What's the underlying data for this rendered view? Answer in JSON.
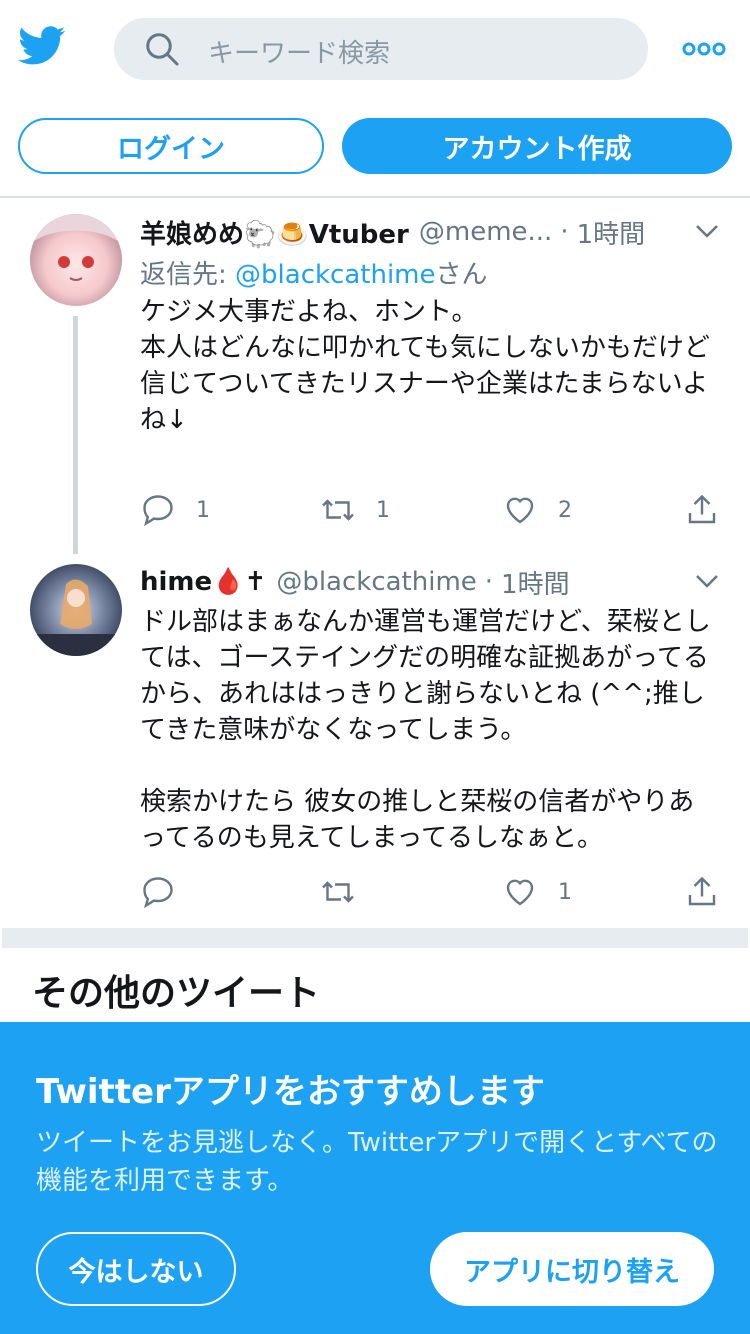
{
  "header": {
    "logo_icon": "twitter-bird-icon",
    "search_placeholder": "キーワード検索",
    "search_icon": "search-icon",
    "more_icon": "more-dots-icon"
  },
  "auth": {
    "login_label": "ログイン",
    "signup_label": "アカウント作成"
  },
  "tweets": [
    {
      "name": "羊娘めめ🐑🍮Vtuber",
      "handle": "@meme...",
      "separator": "·",
      "time": "1時間",
      "reply_prefix": "返信先: ",
      "reply_handle": "@blackcathime",
      "reply_suffix": "さん",
      "body": "ケジメ大事だよね、ホント。\n本人はどんなに叩かれても気にしないかもだけど\n信じてついてきたリスナーや企業はたまらないよね↓",
      "replies": "1",
      "retweets": "1",
      "likes": "2"
    },
    {
      "name": "hime🩸✝",
      "handle": "@blackcathime",
      "separator": "·",
      "time": "1時間",
      "body": "ドル部はまぁなんか運営も運営だけど、栞桜としては、ゴーステイングだの明確な証拠あがってるから、あれははっきりと謝らないとね (^^;推してきた意味がなくなってしまう。\n\n検索かけたら 彼女の推しと栞桜の信者がやりあってるのも見えてしまってるしなぁと。",
      "replies": "",
      "retweets": "",
      "likes": "1"
    }
  ],
  "more_tweets_heading": "その他のツイート",
  "promo": {
    "title": "Twitterアプリをおすすめします",
    "text": "ツイートをお見逃しなく。Twitterアプリで開くとすべての機能を利用できます。",
    "not_now_label": "今はしない",
    "switch_label": "アプリに切り替え"
  },
  "colors": {
    "brand": "#1da1f2",
    "text": "#14171a",
    "secondary": "#657786",
    "divider": "#e6ecf0"
  }
}
